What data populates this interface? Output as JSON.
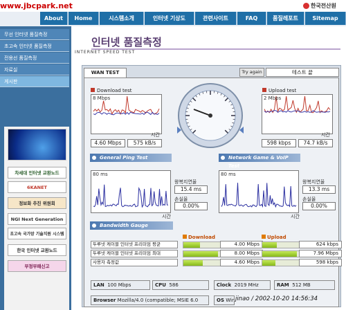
{
  "watermark": "www.jbcpark.net",
  "logo": {
    "text": "한국전산원"
  },
  "nav": [
    "About",
    "Home",
    "시스템소개",
    "인터넷 기상도",
    "관련사이트",
    "FAQ",
    "품질레포트",
    "Sitemap"
  ],
  "sidebar": {
    "items": [
      "무선 인터넷 품질측정",
      "초고속 인터넷 품질측정",
      "전용선 품질측정",
      "자료실",
      "게시판"
    ],
    "banners": [
      "차세대 인터넷 교환노드",
      "6KANET",
      "정보화 추진 위원회",
      "NGI Next Generation",
      "초고속 국가망 기술지원 시스템",
      "한국 인터넷 교환노드",
      "부정부패신고"
    ]
  },
  "page": {
    "title_ko": "인터넷 품질측정",
    "title_en": "INTERNET SPEED TEST"
  },
  "tab": {
    "label": "WAN TEST",
    "try_again": "Try again",
    "status": "테스트 끝"
  },
  "download": {
    "title": "Download test",
    "axis": "8 Mbps",
    "time_label": "시간",
    "mbps": "4.60 Mbps",
    "kbs": "575 kB/s"
  },
  "upload": {
    "title": "Upload test",
    "axis": "2 Mbps",
    "time_label": "시간",
    "mbps": "598 kbps",
    "kbs": "74.7 kB/s"
  },
  "ping": {
    "header": "General Ping Test",
    "axis": "80 ms",
    "rtt_label": "왕복지연율",
    "rtt": "15.4 ms",
    "loss_label": "손실율",
    "loss": "0.00%",
    "time_label": "시간"
  },
  "game": {
    "header": "Network Game & VoIP Test",
    "axis": "80 ms",
    "rtt_label": "왕복지연율",
    "rtt": "13.3 ms",
    "loss_label": "손실율",
    "loss": "0.00%",
    "time_label": "시간"
  },
  "bandwidth": {
    "header": "Bandwidth Gauge",
    "download_label": "Download",
    "upload_label": "Upload",
    "rows": [
      {
        "label": "두루넷 케이블 인터넷 프리미엄 평균",
        "dl": "4.00 Mbps",
        "ul": "624 kbps",
        "dl_frac": 0.25,
        "ul_frac": 0.22
      },
      {
        "label": "두루넷 케이블 인터넷 프리미엄 최대",
        "dl": "8.00 Mbps",
        "ul": "7.96 Mbps",
        "dl_frac": 0.52,
        "ul_frac": 0.52
      },
      {
        "label": "사용자 측정값",
        "dl": "4.60 Mbps",
        "ul": "598 kbps",
        "dl_frac": 0.29,
        "ul_frac": 0.2
      }
    ]
  },
  "sysinfo": {
    "lan_label": "LAN",
    "lan": "100 Mbps",
    "cpu_label": "CPU",
    "cpu": "586",
    "clock_label": "Clock",
    "clock": "2019 MHz",
    "ram_label": "RAM",
    "ram": "512 MB",
    "browser_label": "Browser",
    "browser": "Mozilla/4.0 (compatible; MSIE 6.0",
    "os_label": "OS",
    "os": "Window"
  },
  "timestamp": "jinao / 2002-10-20 14:56:34",
  "colors": {
    "nav": "#1f6fa7",
    "sidebar": "#3b6f9e",
    "download_line": "#c0392b",
    "upload_line": "#3a3aa8",
    "bar": "#9cc832"
  }
}
